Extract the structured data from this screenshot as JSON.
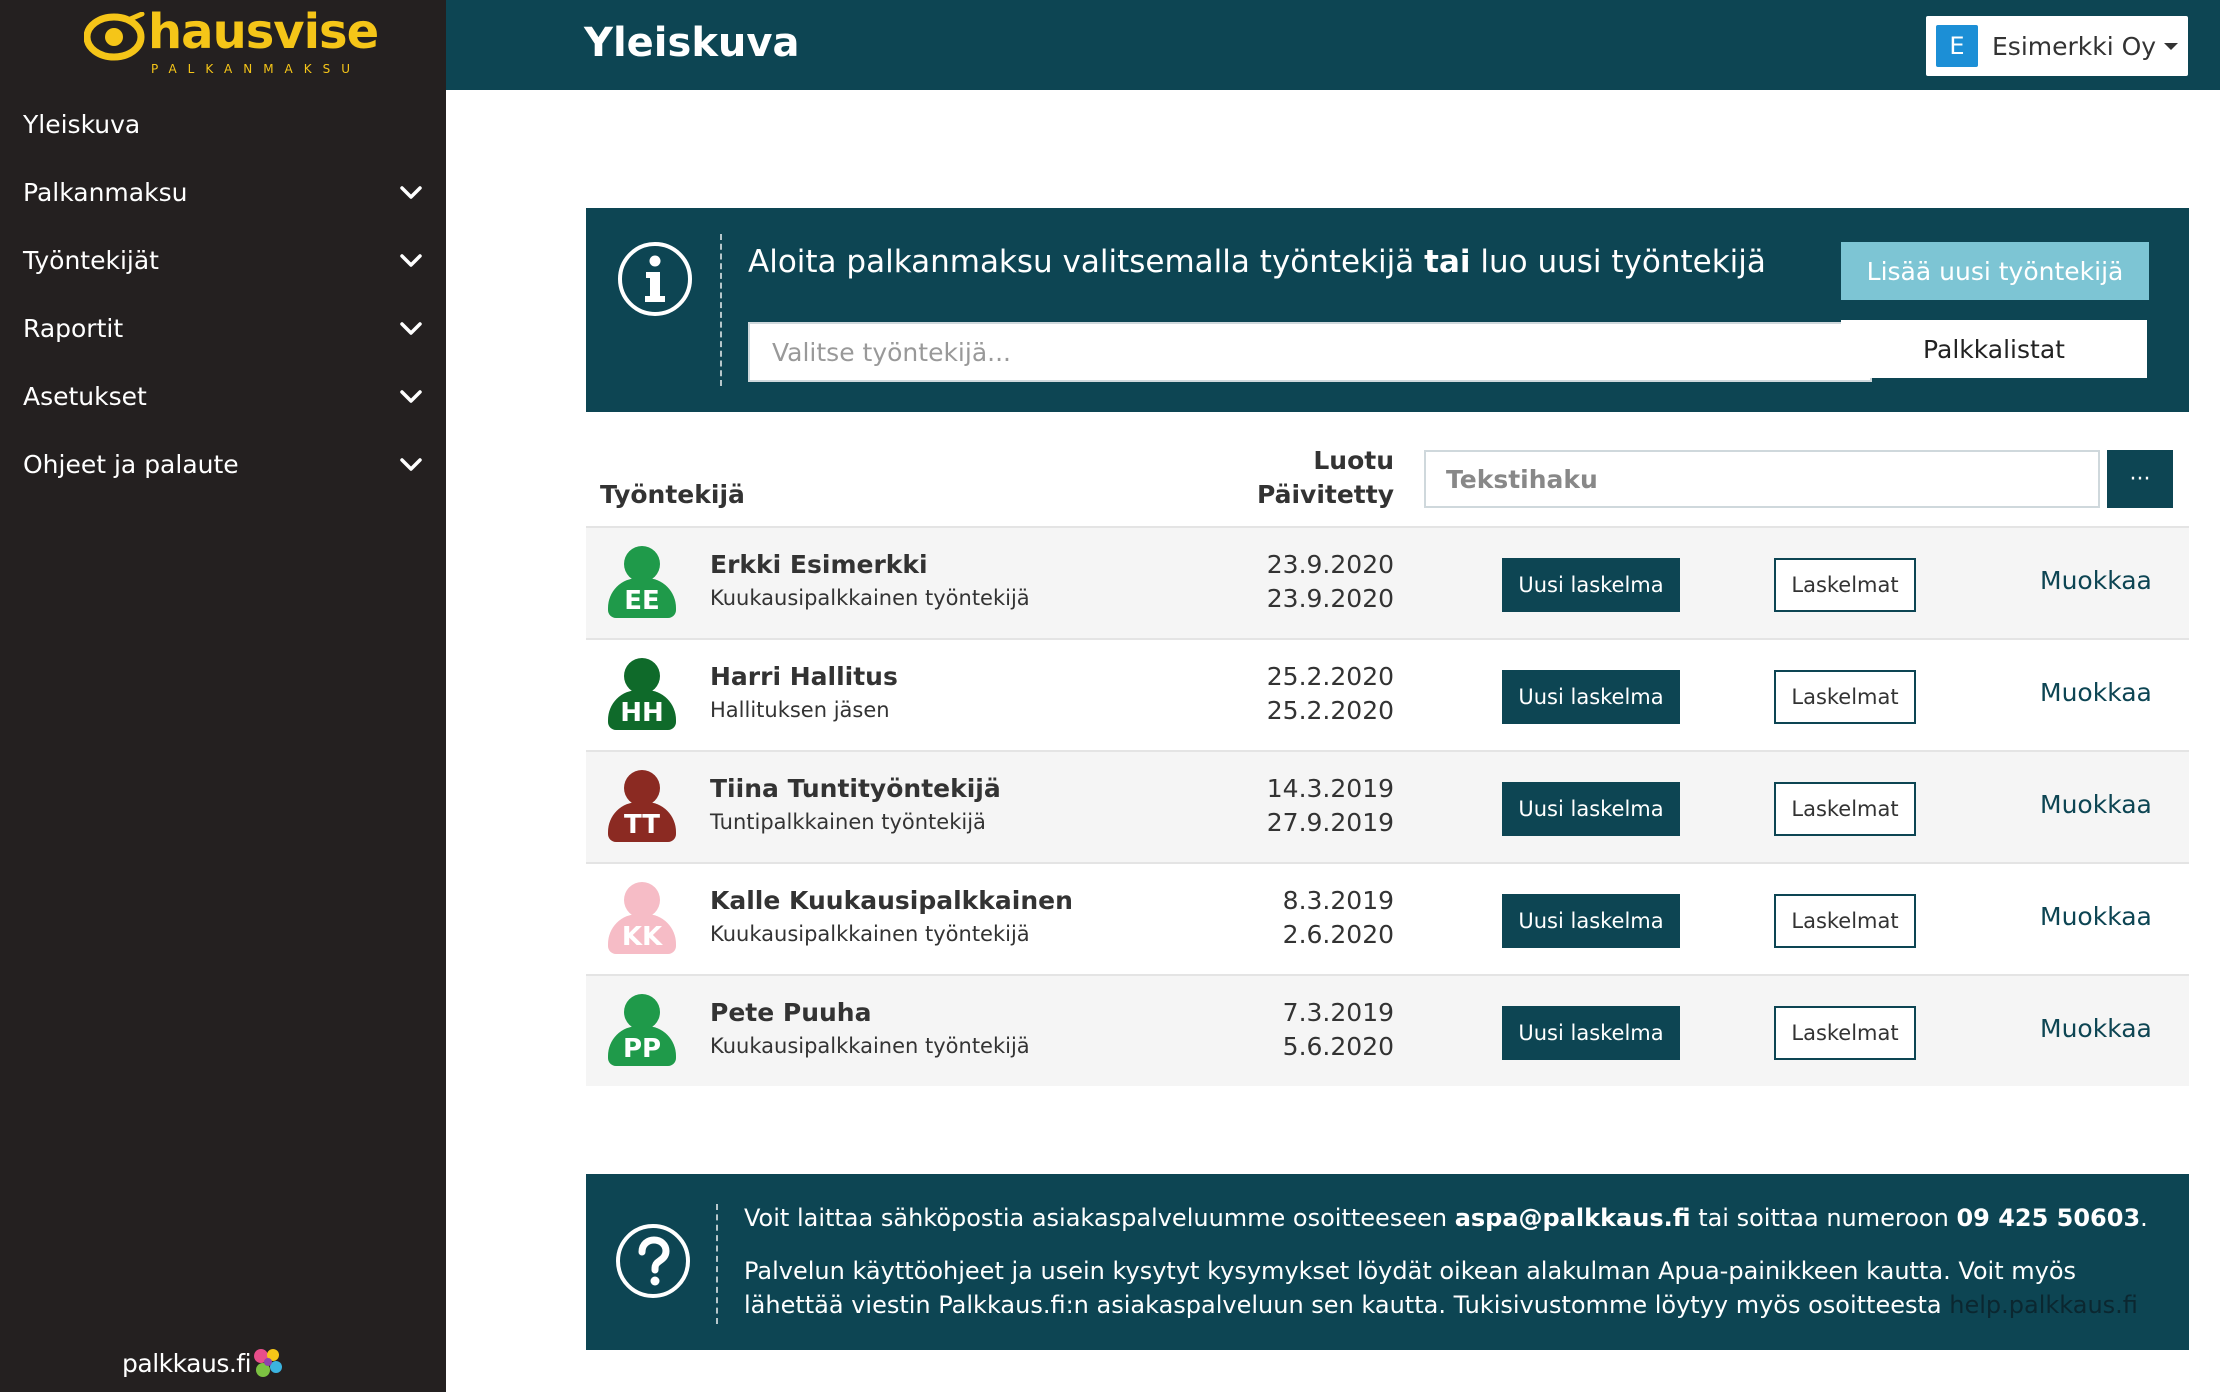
{
  "brand": {
    "name": "hausvise",
    "tagline": "PALKANMAKSU",
    "accent_color": "#f5c518",
    "footer_logo_text": "palkkaus.fi"
  },
  "sidebar": {
    "items": [
      {
        "label": "Yleiskuva",
        "has_submenu": false,
        "icon": ""
      },
      {
        "label": "Palkanmaksu",
        "has_submenu": true,
        "icon": "chevron-down-icon"
      },
      {
        "label": "Työntekijät",
        "has_submenu": true,
        "icon": "chevron-down-icon"
      },
      {
        "label": "Raportit",
        "has_submenu": true,
        "icon": "chevron-down-icon"
      },
      {
        "label": "Asetukset",
        "has_submenu": true,
        "icon": "chevron-down-icon"
      },
      {
        "label": "Ohjeet ja palaute",
        "has_submenu": true,
        "icon": "chevron-down-icon"
      }
    ]
  },
  "header": {
    "title": "Yleiskuva",
    "company": {
      "initial": "E",
      "name": "Esimerkki Oy"
    }
  },
  "info": {
    "text_before": "Aloita palkanmaksu valitsemalla työntekijä ",
    "text_bold": "tai",
    "text_after": " luo uusi työntekijä",
    "select_placeholder": "Valitse työntekijä...",
    "add_button": "Lisää uusi työntekijä",
    "lists_button": "Palkkalistat"
  },
  "table": {
    "header_employee": "Työntekijä",
    "header_created": "Luotu",
    "header_updated": "Päivitetty",
    "search_placeholder": "Tekstihaku",
    "more_button": "···",
    "rows": [
      {
        "initials": "EE",
        "name": "Erkki Esimerkki",
        "role": "Kuukausipalkkainen työntekijä",
        "created": "23.9.2020",
        "updated": "23.9.2020",
        "avatar_color": "#1f9a4a",
        "new_button": "Uusi laskelma",
        "calcs_button": "Laskelmat",
        "edit_link": "Muokkaa"
      },
      {
        "initials": "HH",
        "name": "Harri Hallitus",
        "role": "Hallituksen jäsen",
        "created": "25.2.2020",
        "updated": "25.2.2020",
        "avatar_color": "#0f6a2a",
        "new_button": "Uusi laskelma",
        "calcs_button": "Laskelmat",
        "edit_link": "Muokkaa"
      },
      {
        "initials": "TT",
        "name": "Tiina Tuntityöntekijä",
        "role": "Tuntipalkkainen työntekijä",
        "created": "14.3.2019",
        "updated": "27.9.2019",
        "avatar_color": "#8b2a22",
        "new_button": "Uusi laskelma",
        "calcs_button": "Laskelmat",
        "edit_link": "Muokkaa"
      },
      {
        "initials": "KK",
        "name": "Kalle Kuukausipalkkainen",
        "role": "Kuukausipalkkainen työntekijä",
        "created": "8.3.2019",
        "updated": "2.6.2020",
        "avatar_color": "#f6bcc6",
        "new_button": "Uusi laskelma",
        "calcs_button": "Laskelmat",
        "edit_link": "Muokkaa"
      },
      {
        "initials": "PP",
        "name": "Pete Puuha",
        "role": "Kuukausipalkkainen työntekijä",
        "created": "7.3.2019",
        "updated": "5.6.2020",
        "avatar_color": "#1f9a4a",
        "new_button": "Uusi laskelma",
        "calcs_button": "Laskelmat",
        "edit_link": "Muokkaa"
      }
    ]
  },
  "help": {
    "line1_before": "Voit laittaa sähköpostia asiakaspalveluumme osoitteeseen ",
    "email": "aspa@palkkaus.fi",
    "line1_middle": " tai soittaa numeroon ",
    "phone": "09 425 50603",
    "line1_after": ".",
    "line2": "Palvelun käyttöohjeet ja usein kysytyt kysymykset löydät oikean alakulman Apua-painikkeen kautta. Voit myös lähettää viestin Palkkaus.fi:n asiakaspalveluun sen kautta. Tukisivustomme löytyy myös osoitteesta ",
    "link": "help.palkkaus.fi"
  },
  "colors": {
    "primary": "#0d4553",
    "sidebar": "#242020",
    "add_button": "#7dc5d4",
    "company_badge": "#1c8fd6"
  }
}
